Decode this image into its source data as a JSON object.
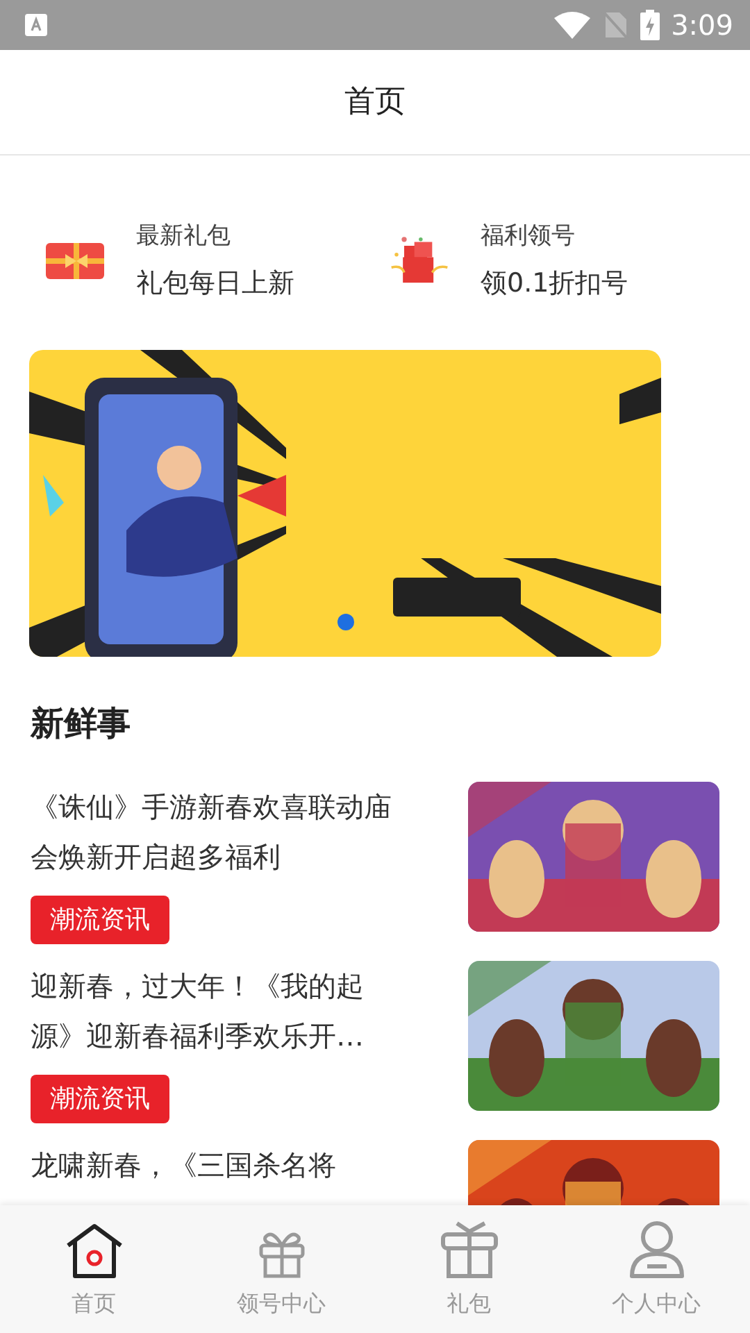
{
  "status_bar": {
    "time": "3:09"
  },
  "header": {
    "title": "首页"
  },
  "features": [
    {
      "kind": "gift-card",
      "title": "最新礼包",
      "subtitle": "礼包每日上新"
    },
    {
      "kind": "gift-box",
      "title": "福利领号",
      "subtitle": "领0.1折扣号"
    }
  ],
  "banner": {
    "kind": "picture",
    "dots": [
      {
        "selected": true
      }
    ]
  },
  "news": {
    "title": "新鲜事",
    "items": [
      {
        "title": "《诛仙》手游新春欢喜联动庙会焕新开启超多福利",
        "tag": "潮流资讯"
      },
      {
        "title": "迎新春，过大年！《我的起源》迎新春福利季欢乐开…",
        "tag": "潮流资讯"
      },
      {
        "title": "龙啸新春，《三国杀名将"
      }
    ]
  },
  "tab_bar": [
    {
      "kind": "home",
      "label": "首页",
      "selected": true
    },
    {
      "kind": "gift",
      "label": "领号中心",
      "selected": false
    },
    {
      "kind": "package",
      "label": "礼包",
      "selected": false
    },
    {
      "kind": "person",
      "label": "个人中心",
      "selected": false
    }
  ]
}
